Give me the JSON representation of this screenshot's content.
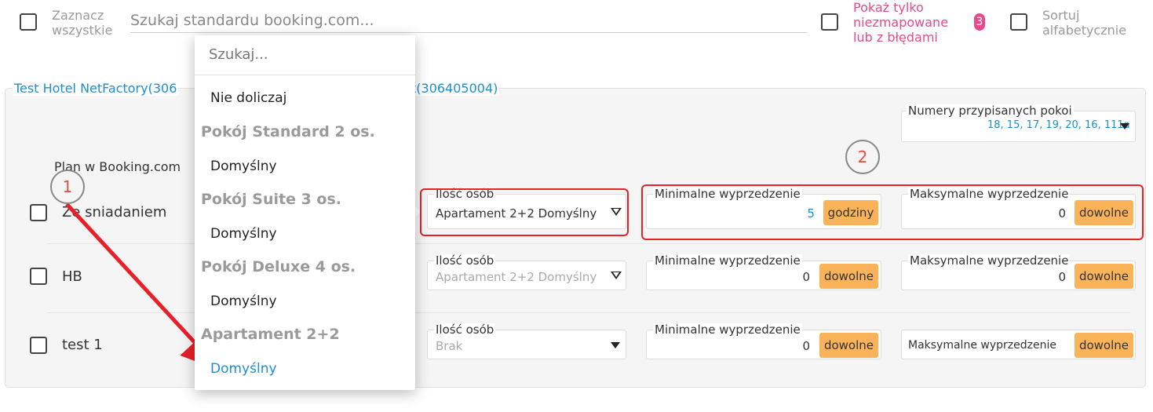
{
  "toolbar": {
    "select_all_line1": "Zaznacz",
    "select_all_line2": "wszystkie",
    "search_placeholder": "Szukaj standardu booking.com...",
    "only_unmapped_line1": "Pokaż tylko",
    "only_unmapped_line2": "niezmapowane",
    "only_unmapped_line3": "lub z błędami",
    "unmapped_count": "3",
    "sort_line1": "Sortuj",
    "sort_line2": "alfabetycznie"
  },
  "section": {
    "legend_left": "Test Hotel NetFactory(306",
    "legend_right": "t(306405004)",
    "assigned_rooms_label": "Numery przypisanych pokoi",
    "assigned_rooms_value": "18, 15, 17, 19, 20, 16, 111a",
    "plan_header": "Plan w Booking.com"
  },
  "rows": [
    {
      "name": "Ze sniadaniem",
      "persons_label": "Ilość osób",
      "persons_value": "Apartament 2+2 Domyślny",
      "min_label": "Minimalne wyprzedzenie",
      "min_value": "5",
      "min_unit": "godziny",
      "max_label": "Maksymalne wyprzedzenie",
      "max_value": "0",
      "max_unit": "dowolne"
    },
    {
      "name": "HB",
      "persons_label": "Ilość osób",
      "persons_value": "Apartament 2+2 Domyślny",
      "min_label": "Minimalne wyprzedzenie",
      "min_value": "0",
      "min_unit": "dowolne",
      "max_label": "Maksymalne wyprzedzenie",
      "max_value": "0",
      "max_unit": "dowolne"
    },
    {
      "name": "test 1",
      "persons_label": "Ilość osób",
      "persons_value": "Brak",
      "min_label": "Minimalne wyprzedzenie",
      "min_value": "0",
      "min_unit": "dowolne",
      "max_label": "Maksymalne wyprzedzenie",
      "max_unit": "dowolne"
    }
  ],
  "dropdown": {
    "search_placeholder": "Szukaj...",
    "items": [
      {
        "type": "option",
        "label": "Nie doliczaj"
      },
      {
        "type": "group",
        "label": "Pokój Standard 2 os."
      },
      {
        "type": "option",
        "label": "Domyślny"
      },
      {
        "type": "group",
        "label": "Pokój Suite 3 os."
      },
      {
        "type": "option",
        "label": "Domyślny"
      },
      {
        "type": "group",
        "label": "Pokój Deluxe 4 os."
      },
      {
        "type": "option",
        "label": "Domyślny"
      },
      {
        "type": "group",
        "label": "Apartament 2+2"
      },
      {
        "type": "option",
        "label": "Domyślny",
        "selected": true
      }
    ]
  },
  "annotations": {
    "step1": "1",
    "step2": "2",
    "highlight_color": "#e8202a"
  },
  "colors": {
    "accent_blue": "#1a8fd1",
    "pink": "#e64a8e",
    "unit_orange": "#fbb35a"
  }
}
